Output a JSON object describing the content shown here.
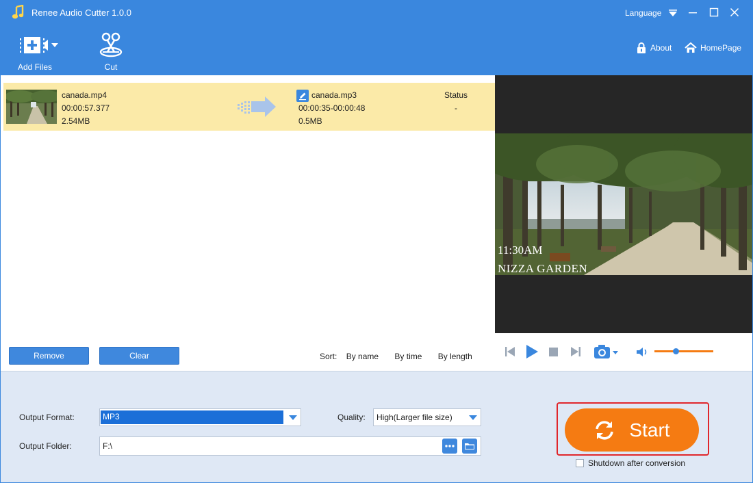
{
  "window": {
    "title": "Renee Audio Cutter 1.0.0",
    "language_label": "Language"
  },
  "toolbar": {
    "add_files_label": "Add Files",
    "cut_label": "Cut",
    "about_label": "About",
    "homepage_label": "HomePage"
  },
  "file_list": {
    "items": [
      {
        "source_name": "canada.mp4",
        "source_duration": "00:00:57.377",
        "source_size": "2.54MB",
        "output_name": "canada.mp3",
        "output_range": "00:00:35-00:00:48",
        "output_size": "0.5MB",
        "status_header": "Status",
        "status_value": "-"
      }
    ],
    "remove_label": "Remove",
    "clear_label": "Clear",
    "sort_label": "Sort:",
    "sort_by_name": "By name",
    "sort_by_time": "By time",
    "sort_by_length": "By length"
  },
  "preview": {
    "overlay_time": "11:30AM",
    "overlay_place": "NIZZA GARDEN",
    "volume_level": 0.36
  },
  "output": {
    "format_label": "Output Format:",
    "format_value": "MP3",
    "quality_label": "Quality:",
    "quality_value": "High(Larger file size)",
    "folder_label": "Output Folder:",
    "folder_value": "F:\\"
  },
  "start": {
    "label": "Start",
    "shutdown_label": "Shutdown after conversion"
  },
  "colors": {
    "brand_blue": "#3a87de",
    "row_highlight": "#fbeaa8",
    "start_orange": "#f57b12",
    "highlight_frame": "#e0262b"
  }
}
